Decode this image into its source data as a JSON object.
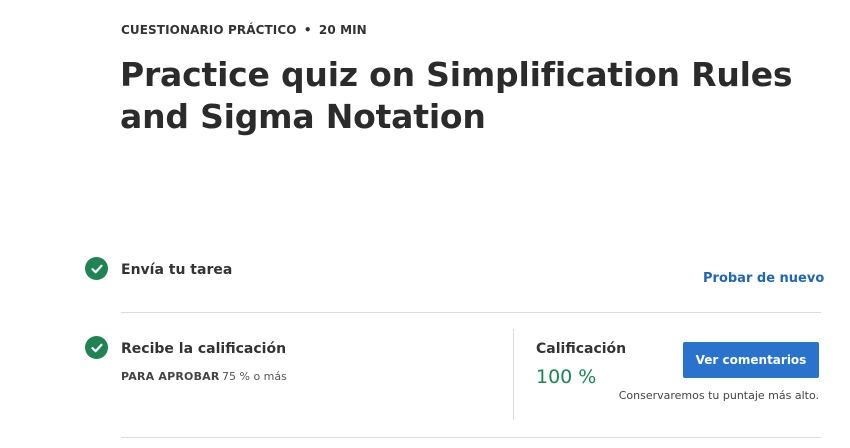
{
  "header": {
    "eyebrow_type": "CUESTIONARIO PRÁCTICO",
    "eyebrow_separator": "•",
    "eyebrow_duration": "20 MIN",
    "title": "Practice quiz on Simplification Rules and Sigma Notation"
  },
  "steps": [
    {
      "label": "Envía tu tarea",
      "icon": "check-circle-icon",
      "status": "complete",
      "action_label": "Probar de nuevo"
    },
    {
      "label": "Recibe la calificación",
      "icon": "check-circle-icon",
      "status": "complete",
      "pass_label": "PARA APROBAR",
      "pass_value": "75 % o más"
    }
  ],
  "grade": {
    "label": "Calificación",
    "value": "100 %",
    "button_label": "Ver comentarios",
    "note": "Conservaremos tu puntaje más alto."
  },
  "colors": {
    "success": "#1f8354",
    "primary": "#2a73cc",
    "link": "#1f65b8",
    "divider": "#dcdcdc"
  }
}
